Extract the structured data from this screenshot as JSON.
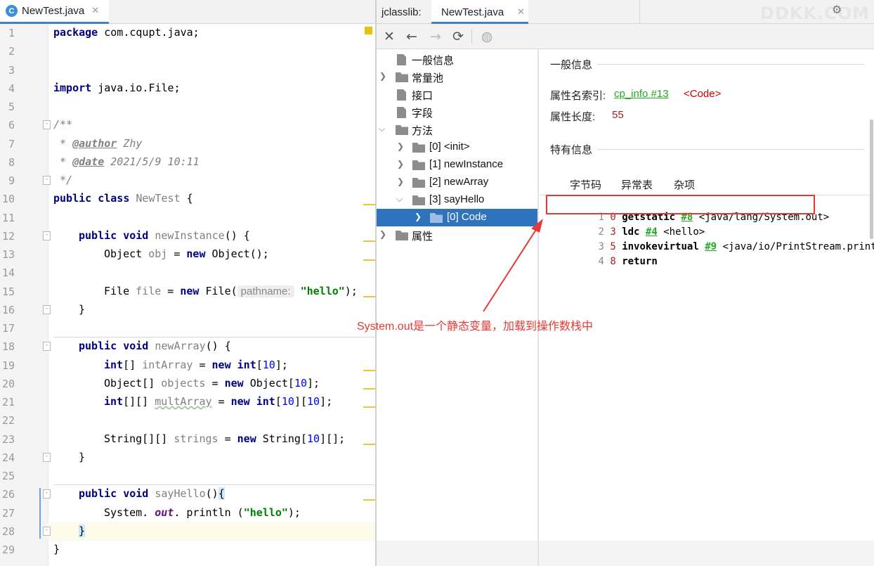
{
  "editor": {
    "tab_title": "NewTest.java",
    "tab_icon": "C",
    "lines": [
      {
        "n": "1"
      },
      {
        "n": "2"
      },
      {
        "n": "3"
      },
      {
        "n": "4"
      },
      {
        "n": "5"
      },
      {
        "n": "6"
      },
      {
        "n": "7"
      },
      {
        "n": "8"
      },
      {
        "n": "9"
      },
      {
        "n": "10"
      },
      {
        "n": "11"
      },
      {
        "n": "12"
      },
      {
        "n": "13"
      },
      {
        "n": "14"
      },
      {
        "n": "15"
      },
      {
        "n": "16"
      },
      {
        "n": "17"
      },
      {
        "n": "18"
      },
      {
        "n": "19"
      },
      {
        "n": "20"
      },
      {
        "n": "21"
      },
      {
        "n": "22"
      },
      {
        "n": "23"
      },
      {
        "n": "24"
      },
      {
        "n": "25"
      },
      {
        "n": "26"
      },
      {
        "n": "27"
      },
      {
        "n": "28"
      },
      {
        "n": "29"
      }
    ],
    "code": {
      "l1_kw": "package",
      "l1_rest": " com.cqupt.java;",
      "l4_kw": "import",
      "l4_rest": " java.io.File;",
      "l6": "/**",
      "l7_pre": " * ",
      "l7_tag": "@author",
      "l7_val": " Zhy",
      "l8_pre": " * ",
      "l8_tag": "@date",
      "l8_val": " 2021/5/9 10:11",
      "l9": " */",
      "l10_kw": "public class",
      "l10_name": " NewTest",
      "l10_rest": " {",
      "l12_kw": "public void",
      "l12_name": " newInstance",
      "l12_rest": "() {",
      "l13_a": "Object ",
      "l13_var": "obj",
      "l13_b": " = ",
      "l13_kw": "new",
      "l13_c": " Object();",
      "l15_a": "File ",
      "l15_var": "file",
      "l15_b": " = ",
      "l15_kw": "new",
      "l15_c": " File(",
      "l15_hint": "pathname:",
      "l15_str": "\"hello\"",
      "l15_d": ");",
      "l16": "}",
      "l18_kw": "public void",
      "l18_name": " newArray",
      "l18_rest": "() {",
      "l19_kw": "int",
      "l19_a": "[] ",
      "l19_var": "intArray",
      "l19_b": " = ",
      "l19_kw2": "new",
      "l19_kw3": " int",
      "l19_c": "[",
      "l19_num": "10",
      "l19_d": "];",
      "l20_a": "Object[] ",
      "l20_var": "objects",
      "l20_b": " = ",
      "l20_kw": "new",
      "l20_c": " Object[",
      "l20_num": "10",
      "l20_d": "];",
      "l21_kw": "int",
      "l21_a": "[][] ",
      "l21_var": "multArray",
      "l21_b": " = ",
      "l21_kw2": "new",
      "l21_kw3": " int",
      "l21_c": "[",
      "l21_num": "10",
      "l21_d": "][",
      "l21_num2": "10",
      "l21_e": "];",
      "l23_a": "String[][] ",
      "l23_var": "strings",
      "l23_b": " = ",
      "l23_kw": "new",
      "l23_c": " String[",
      "l23_num": "10",
      "l23_d": "][];",
      "l24": "}",
      "l26_kw": "public void",
      "l26_name": " sayHello",
      "l26_rest": "()",
      "l26_brace": "{",
      "l27_a": "System. ",
      "l27_static": "out",
      "l27_b": ". println (",
      "l27_str": "\"hello\"",
      "l27_c": ");",
      "l28": "}",
      "l29": "}"
    }
  },
  "jclasslib": {
    "label": "jclasslib:",
    "tab_title": "NewTest.java",
    "watermark": "DDKK.COM",
    "toolbar": [
      "close-icon",
      "back-icon",
      "forward-icon",
      "refresh-icon",
      "browser-icon"
    ],
    "tree": [
      {
        "label": "一般信息",
        "icon": "file",
        "arrow": ""
      },
      {
        "label": "常量池",
        "icon": "folder",
        "arrow": "›"
      },
      {
        "label": "接口",
        "icon": "file",
        "arrow": ""
      },
      {
        "label": "字段",
        "icon": "file",
        "arrow": ""
      },
      {
        "label": "方法",
        "icon": "folder",
        "arrow": "⌄"
      },
      {
        "label": "[0] <init>",
        "icon": "folder",
        "arrow": "›"
      },
      {
        "label": "[1] newInstance",
        "icon": "folder",
        "arrow": "›"
      },
      {
        "label": "[2] newArray",
        "icon": "folder",
        "arrow": "›"
      },
      {
        "label": "[3] sayHello",
        "icon": "folder",
        "arrow": "⌄"
      },
      {
        "label": "[0] Code",
        "icon": "folder",
        "arrow": "›",
        "selected": true
      },
      {
        "label": "属性",
        "icon": "folder",
        "arrow": "›"
      }
    ],
    "detail": {
      "general_title": "一般信息",
      "name_index_label": "属性名索引:",
      "name_index_link": "cp_info #13",
      "name_index_value": "<Code>",
      "length_label": "属性长度:",
      "length_value": "55",
      "specific_title": "特有信息",
      "sub_tabs": [
        "字节码",
        "异常表",
        "杂项"
      ],
      "bytecode": [
        {
          "idx": "1",
          "off": "0",
          "op": "getstatic",
          "ref": "#8",
          "arg": "<java/lang/System.out>"
        },
        {
          "idx": "2",
          "off": "3",
          "op": "ldc",
          "ref": "#4",
          "arg": "<hello>"
        },
        {
          "idx": "3",
          "off": "5",
          "op": "invokevirtual",
          "ref": "#9",
          "arg": "<java/io/PrintStream.println>"
        },
        {
          "idx": "4",
          "off": "8",
          "op": "return",
          "ref": "",
          "arg": ""
        }
      ]
    }
  },
  "annotation": {
    "text": "System.out是一个静态变量，加载到操作数栈中",
    "color": "#e53935"
  }
}
